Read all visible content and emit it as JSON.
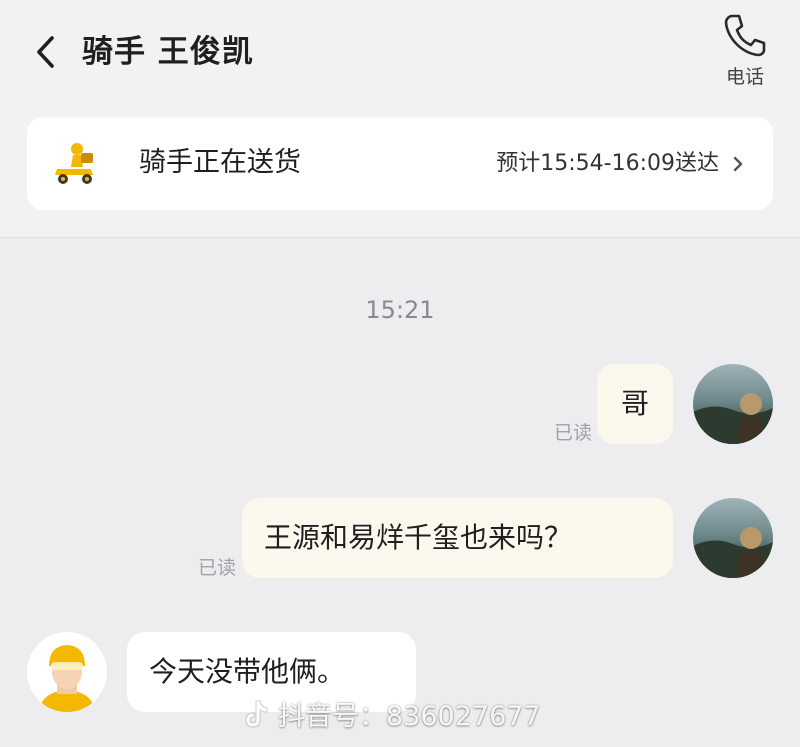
{
  "header": {
    "title": "骑手 王俊凯",
    "call_label": "电话",
    "accent_color": "#1f1f1f"
  },
  "status_card": {
    "status_text": "骑手正在送货",
    "eta_text": "预计15:54-16:09送达",
    "icon": "scooter-delivery-icon",
    "icon_color": "#f5b800"
  },
  "chat": {
    "time_divider": "15:21",
    "messages": [
      {
        "sender": "me",
        "text": "哥",
        "read_label": "已读"
      },
      {
        "sender": "me",
        "text": "王源和易烊千玺也来吗？",
        "read_label": "已读"
      },
      {
        "sender": "rider",
        "text": "今天没带他俩。"
      }
    ]
  },
  "watermark": {
    "text": "抖音号：836027677",
    "icon": "tiktok-icon"
  }
}
